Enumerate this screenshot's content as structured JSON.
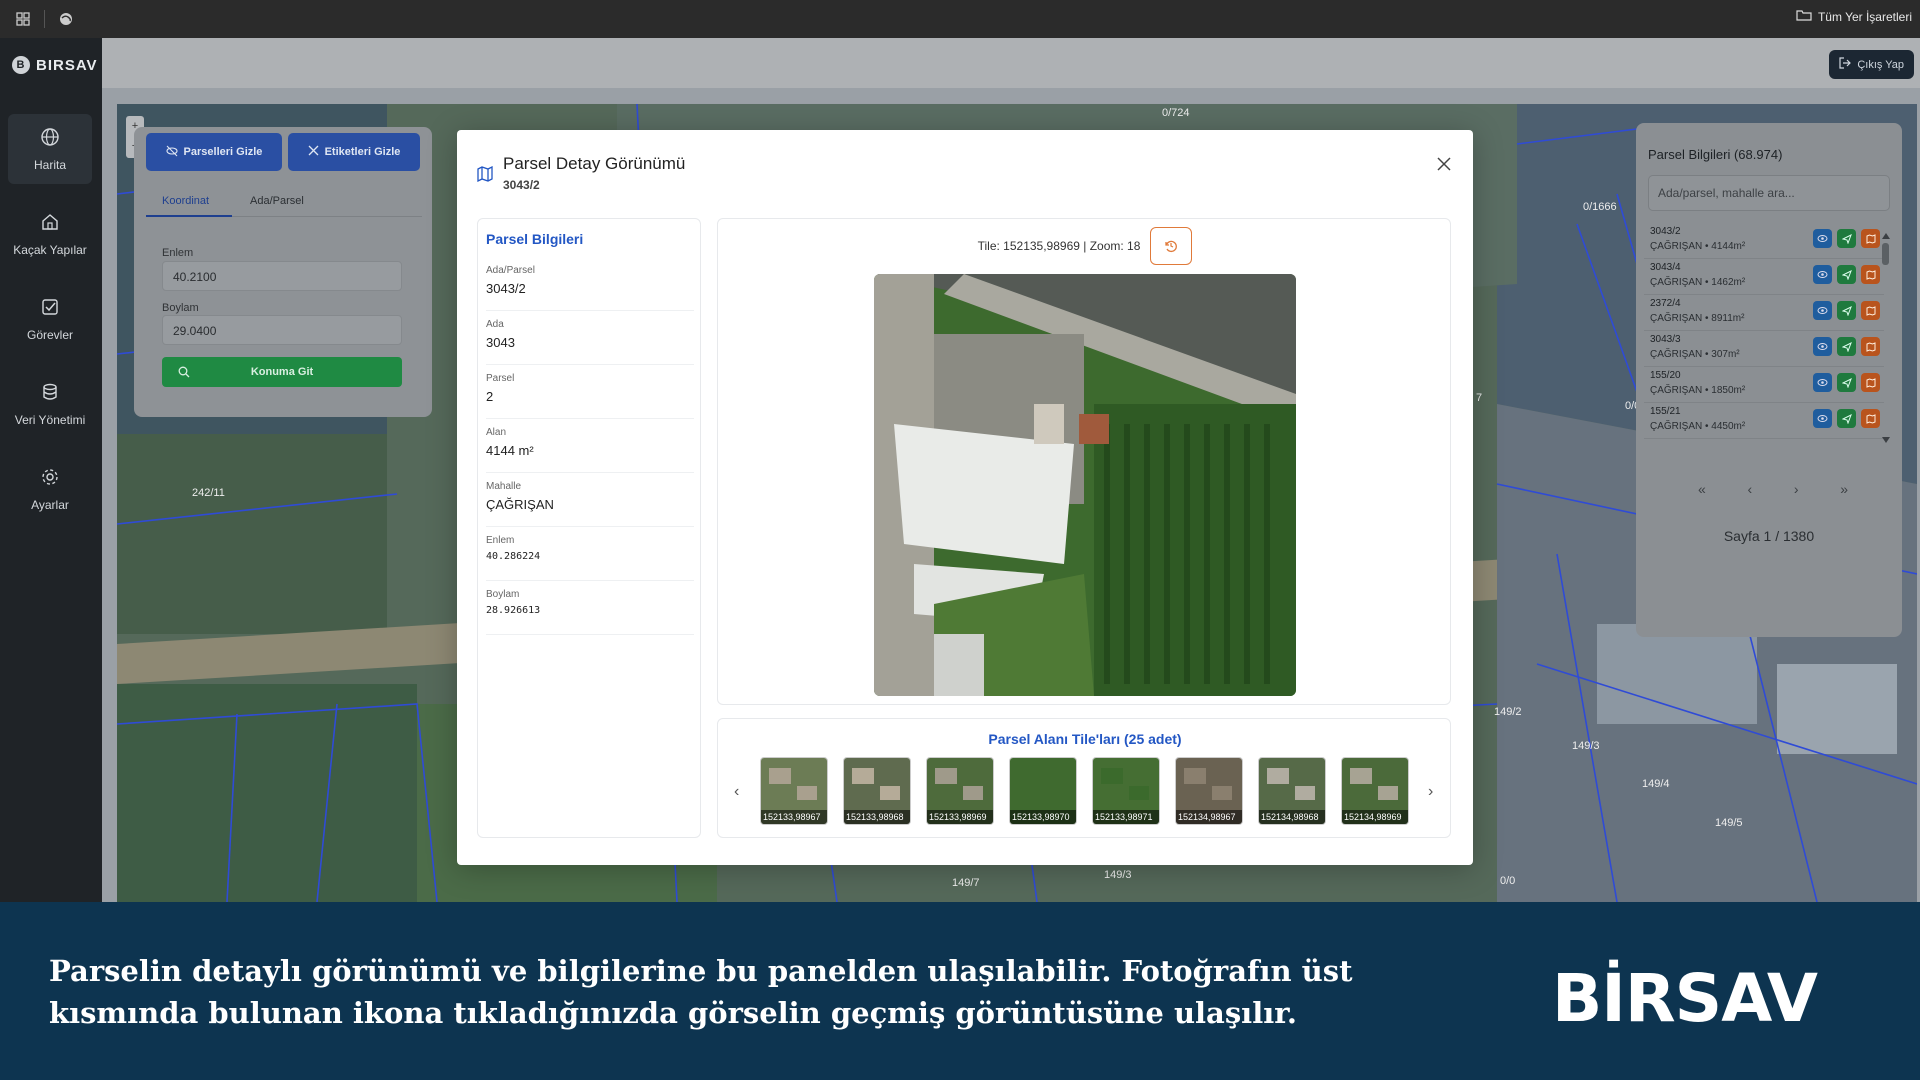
{
  "topbar": {
    "markers_label": "Tüm Yer İşaretleri"
  },
  "brand": {
    "name": "BIRSAV",
    "initial": "B"
  },
  "nav": [
    {
      "label": "Harita",
      "icon": "globe-icon",
      "active": true
    },
    {
      "label": "Kaçak Yapılar",
      "icon": "home-icon"
    },
    {
      "label": "Görevler",
      "icon": "checkbox-icon"
    },
    {
      "label": "Veri Yönetimi",
      "icon": "database-icon"
    },
    {
      "label": "Ayarlar",
      "icon": "gear-icon"
    }
  ],
  "header": {
    "logout_label": "Çıkış Yap"
  },
  "map_labels": [
    "0/724",
    "0/1666",
    "0/0",
    "242/11",
    "0/0",
    "149/2",
    "149/3",
    "149/4",
    "149/5",
    "149/7",
    "149/3",
    "0/0",
    "7"
  ],
  "left_panel": {
    "hide_parcels": "Parselleri Gizle",
    "hide_labels": "Etiketleri Gizle",
    "tab_coord": "Koordinat",
    "tab_parcel": "Ada/Parsel",
    "lat_label": "Enlem",
    "lat_value": "40.2100",
    "lon_label": "Boylam",
    "lon_value": "29.0400",
    "go_button": "Konuma Git"
  },
  "right_panel": {
    "title": "Parsel Bilgileri (68.974)",
    "search_placeholder": "Ada/parsel, mahalle ara...",
    "rows": [
      {
        "id": "3043/2",
        "detail": "ÇAĞRIŞAN • 4144m²"
      },
      {
        "id": "3043/4",
        "detail": "ÇAĞRIŞAN • 1462m²"
      },
      {
        "id": "2372/4",
        "detail": "ÇAĞRIŞAN • 8911m²"
      },
      {
        "id": "3043/3",
        "detail": "ÇAĞRIŞAN • 307m²"
      },
      {
        "id": "155/20",
        "detail": "ÇAĞRIŞAN • 1850m²"
      },
      {
        "id": "155/21",
        "detail": "ÇAĞRIŞAN • 4450m²"
      }
    ],
    "page_text": "Sayfa 1 / 1380"
  },
  "modal": {
    "title": "Parsel Detay Görünümü",
    "subtitle": "3043/2",
    "info_title": "Parsel Bilgileri",
    "fields": [
      {
        "label": "Ada/Parsel",
        "value": "3043/2"
      },
      {
        "label": "Ada",
        "value": "3043"
      },
      {
        "label": "Parsel",
        "value": "2"
      },
      {
        "label": "Alan",
        "value": "4144 m²"
      },
      {
        "label": "Mahalle",
        "value": "ÇAĞRIŞAN"
      },
      {
        "label": "Enlem",
        "value": "40.286224"
      },
      {
        "label": "Boylam",
        "value": "28.926613"
      }
    ],
    "tile_info": "Tile: 152135,98969 | Zoom: 18",
    "tiles_title": "Parsel Alanı Tile'ları (25 adet)",
    "tiles": [
      "152133,98967",
      "152133,98968",
      "152133,98969",
      "152133,98970",
      "152133,98971",
      "152134,98967",
      "152134,98968",
      "152134,98969"
    ]
  },
  "caption": {
    "text": "Parselin detaylı görünümü ve bilgilerine bu panelden ulaşılabilir. Fotoğrafın üst kısmında bulunan ikona tıkladığınızda görselin geçmiş görüntüsüne ulaşılır.",
    "logo": "BİRSAV"
  },
  "colors": {
    "accent_blue": "#2357c4",
    "history_orange": "#e07a3a",
    "caption_bg": "#0d3450",
    "go_green": "#1f8a43"
  }
}
